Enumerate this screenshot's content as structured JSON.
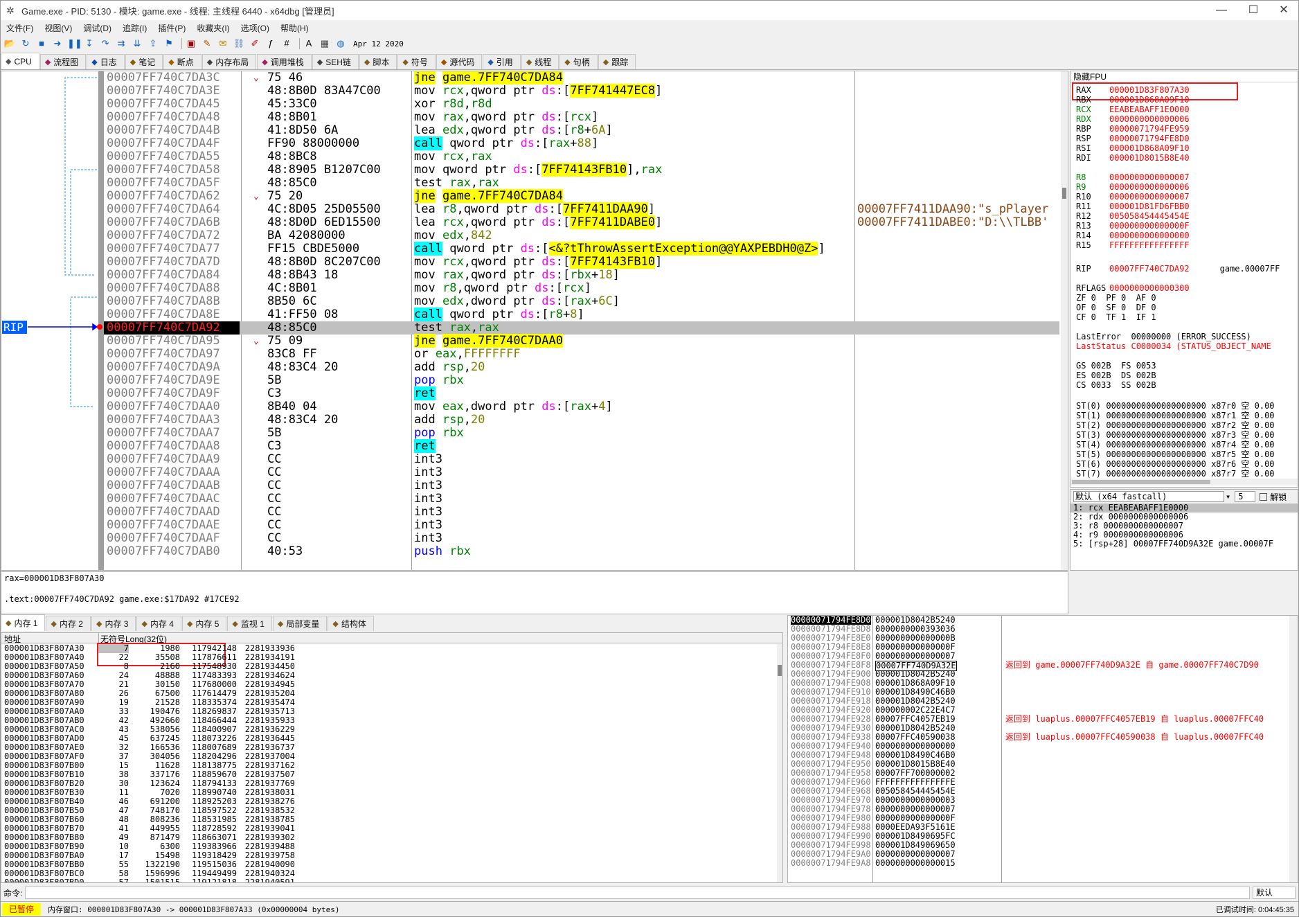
{
  "title": "Game.exe - PID: 5130 - 模块: game.exe - 线程: 主线程 6440 - x64dbg [管理员]",
  "menu": [
    "文件(F)",
    "视图(V)",
    "调试(D)",
    "追踪(I)",
    "插件(P)",
    "收藏夹(I)",
    "选项(O)",
    "帮助(H)",
    "Apr 12 2020"
  ],
  "tabs": [
    {
      "label": "CPU",
      "icon": "cpu-icon"
    },
    {
      "label": "流程图",
      "icon": "graph-icon"
    },
    {
      "label": "日志",
      "icon": "log-icon"
    },
    {
      "label": "笔记",
      "icon": "notes-icon"
    },
    {
      "label": "断点",
      "icon": "breakpoint-icon"
    },
    {
      "label": "内存布局",
      "icon": "memory-map-icon"
    },
    {
      "label": "调用堆栈",
      "icon": "callstack-icon"
    },
    {
      "label": "SEH链",
      "icon": "seh-icon"
    },
    {
      "label": "脚本",
      "icon": "script-icon"
    },
    {
      "label": "符号",
      "icon": "symbol-icon"
    },
    {
      "label": "源代码",
      "icon": "source-icon"
    },
    {
      "label": "引用",
      "icon": "references-icon"
    },
    {
      "label": "线程",
      "icon": "threads-icon"
    },
    {
      "label": "句柄",
      "icon": "handles-icon"
    },
    {
      "label": "跟踪",
      "icon": "trace-icon"
    }
  ],
  "rip_label": "RIP",
  "disasm": [
    {
      "addr": "00007FF740C7DA3C",
      "bytes": "75 46",
      "mn": "jne",
      "ops": "game.7FF740C7DA84",
      "type": "jump"
    },
    {
      "addr": "00007FF740C7DA3E",
      "bytes": "48:8B0D 83A47C00",
      "mn": "mov",
      "ops": "rcx,qword ptr ds:[7FF741447EC8]",
      "type": "mov"
    },
    {
      "addr": "00007FF740C7DA45",
      "bytes": "45:33C0",
      "mn": "xor",
      "ops": "r8d,r8d",
      "type": "plain"
    },
    {
      "addr": "00007FF740C7DA48",
      "bytes": "48:8B01",
      "mn": "mov",
      "ops": "rax,qword ptr ds:[rcx]",
      "type": "plain"
    },
    {
      "addr": "00007FF740C7DA4B",
      "bytes": "41:8D50 6A",
      "mn": "lea",
      "ops": "edx,qword ptr ds:[r8+6A]",
      "type": "plain"
    },
    {
      "addr": "00007FF740C7DA4F",
      "bytes": "FF90 88000000",
      "mn": "call",
      "ops": "qword ptr ds:[rax+88]",
      "type": "call"
    },
    {
      "addr": "00007FF740C7DA55",
      "bytes": "48:8BC8",
      "mn": "mov",
      "ops": "rcx,rax",
      "type": "plain"
    },
    {
      "addr": "00007FF740C7DA58",
      "bytes": "48:8905 B1207C00",
      "mn": "mov",
      "ops": "qword ptr ds:[7FF74143FB10],rax",
      "type": "mov"
    },
    {
      "addr": "00007FF740C7DA5F",
      "bytes": "48:85C0",
      "mn": "test",
      "ops": "rax,rax",
      "type": "plain"
    },
    {
      "addr": "00007FF740C7DA62",
      "bytes": "75 20",
      "mn": "jne",
      "ops": "game.7FF740C7DA84",
      "type": "jump"
    },
    {
      "addr": "00007FF740C7DA64",
      "bytes": "4C:8D05 25D05500",
      "mn": "lea",
      "ops": "r8,qword ptr ds:[7FF7411DAA90]",
      "type": "mov",
      "comment": "00007FF7411DAA90:\"s_pPlayer"
    },
    {
      "addr": "00007FF740C7DA6B",
      "bytes": "48:8D0D 6ED15500",
      "mn": "lea",
      "ops": "rcx,qword ptr ds:[7FF7411DABE0]",
      "type": "mov",
      "comment": "00007FF7411DABE0:\"D:\\\\TLBB'"
    },
    {
      "addr": "00007FF740C7DA72",
      "bytes": "BA 42080000",
      "mn": "mov",
      "ops": "edx,842",
      "type": "plain"
    },
    {
      "addr": "00007FF740C7DA77",
      "bytes": "FF15 CBDE5000",
      "mn": "call",
      "ops": "qword ptr ds:[<&?tThrowAssertException@@YAXPEBDH0@Z>]",
      "type": "call"
    },
    {
      "addr": "00007FF740C7DA7D",
      "bytes": "48:8B0D 8C207C00",
      "mn": "mov",
      "ops": "rcx,qword ptr ds:[7FF74143FB10]",
      "type": "mov"
    },
    {
      "addr": "00007FF740C7DA84",
      "bytes": "48:8B43 18",
      "mn": "mov",
      "ops": "rax,qword ptr ds:[rbx+18]",
      "type": "plain"
    },
    {
      "addr": "00007FF740C7DA88",
      "bytes": "4C:8B01",
      "mn": "mov",
      "ops": "r8,qword ptr ds:[rcx]",
      "type": "plain"
    },
    {
      "addr": "00007FF740C7DA8B",
      "bytes": "8B50 6C",
      "mn": "mov",
      "ops": "edx,dword ptr ds:[rax+6C]",
      "type": "plain"
    },
    {
      "addr": "00007FF740C7DA8E",
      "bytes": "41:FF50 08",
      "mn": "call",
      "ops": "qword ptr ds:[r8+8]",
      "type": "call"
    },
    {
      "addr": "00007FF740C7DA92",
      "bytes": "48:85C0",
      "mn": "test",
      "ops": "rax,rax",
      "type": "plain",
      "current": true
    },
    {
      "addr": "00007FF740C7DA95",
      "bytes": "75 09",
      "mn": "jne",
      "ops": "game.7FF740C7DAA0",
      "type": "jump"
    },
    {
      "addr": "00007FF740C7DA97",
      "bytes": "83C8 FF",
      "mn": "or",
      "ops": "eax,FFFFFFFF",
      "type": "plain"
    },
    {
      "addr": "00007FF740C7DA9A",
      "bytes": "48:83C4 20",
      "mn": "add",
      "ops": "rsp,20",
      "type": "plain"
    },
    {
      "addr": "00007FF740C7DA9E",
      "bytes": "5B",
      "mn": "pop",
      "ops": "rbx",
      "type": "pp"
    },
    {
      "addr": "00007FF740C7DA9F",
      "bytes": "C3",
      "mn": "ret",
      "ops": "",
      "type": "ret"
    },
    {
      "addr": "00007FF740C7DAA0",
      "bytes": "8B40 04",
      "mn": "mov",
      "ops": "eax,dword ptr ds:[rax+4]",
      "type": "plain"
    },
    {
      "addr": "00007FF740C7DAA3",
      "bytes": "48:83C4 20",
      "mn": "add",
      "ops": "rsp,20",
      "type": "plain"
    },
    {
      "addr": "00007FF740C7DAA7",
      "bytes": "5B",
      "mn": "pop",
      "ops": "rbx",
      "type": "pp"
    },
    {
      "addr": "00007FF740C7DAA8",
      "bytes": "C3",
      "mn": "ret",
      "ops": "",
      "type": "ret"
    },
    {
      "addr": "00007FF740C7DAA9",
      "bytes": "CC",
      "mn": "int3",
      "ops": "",
      "type": "plain"
    },
    {
      "addr": "00007FF740C7DAAA",
      "bytes": "CC",
      "mn": "int3",
      "ops": "",
      "type": "plain"
    },
    {
      "addr": "00007FF740C7DAAB",
      "bytes": "CC",
      "mn": "int3",
      "ops": "",
      "type": "plain"
    },
    {
      "addr": "00007FF740C7DAAC",
      "bytes": "CC",
      "mn": "int3",
      "ops": "",
      "type": "plain"
    },
    {
      "addr": "00007FF740C7DAAD",
      "bytes": "CC",
      "mn": "int3",
      "ops": "",
      "type": "plain"
    },
    {
      "addr": "00007FF740C7DAAE",
      "bytes": "CC",
      "mn": "int3",
      "ops": "",
      "type": "plain"
    },
    {
      "addr": "00007FF740C7DAAF",
      "bytes": "CC",
      "mn": "int3",
      "ops": "",
      "type": "plain"
    },
    {
      "addr": "00007FF740C7DAB0",
      "bytes": "40:53",
      "mn": "push",
      "ops": "rbx",
      "type": "pp"
    }
  ],
  "regs_header": "隐藏FPU",
  "registers": [
    {
      "n": "RAX",
      "v": "000001D83F807A30"
    },
    {
      "n": "RBX",
      "v": "000001D868A09F10"
    },
    {
      "n": "RCX",
      "v": "EEABEABAFF1E0000"
    },
    {
      "n": "RDX",
      "v": "0000000000000006"
    },
    {
      "n": "RBP",
      "v": "00000071794FE959"
    },
    {
      "n": "RSP",
      "v": "00000071794FE8D0"
    },
    {
      "n": "RSI",
      "v": "000001D868A09F10"
    },
    {
      "n": "RDI",
      "v": "000001D8015B8E40"
    },
    {
      "n": "R8",
      "v": "0000000000000007"
    },
    {
      "n": "R9",
      "v": "0000000000000006"
    },
    {
      "n": "R10",
      "v": "0000000000000007"
    },
    {
      "n": "R11",
      "v": "000001D81FD6FBB0"
    },
    {
      "n": "R12",
      "v": "005058454445454E"
    },
    {
      "n": "R13",
      "v": "000000000000000F"
    },
    {
      "n": "R14",
      "v": "0000000000000000"
    },
    {
      "n": "R15",
      "v": "FFFFFFFFFFFFFFFF"
    }
  ],
  "rip": {
    "n": "RIP",
    "v": "00007FF740C7DA92",
    "c": "game.00007FF"
  },
  "rflags": {
    "n": "RFLAGS",
    "v": "0000000000000300"
  },
  "flags": [
    "ZF 0  PF 0  AF 0",
    "OF 0  SF 0  DF 0",
    "CF 0  TF 1  IF 1"
  ],
  "lasterror": "LastError  00000000 (ERROR_SUCCESS)",
  "laststatus": "LastStatus C0000034 (STATUS_OBJECT_NAME",
  "segs": [
    "GS 002B  FS 0053",
    "ES 002B  DS 002B",
    "CS 0033  SS 002B"
  ],
  "fpu": [
    "ST(0) 00000000000000000000 x87r0 空 0.00",
    "ST(1) 00000000000000000000 x87r1 空 0.00",
    "ST(2) 00000000000000000000 x87r2 空 0.00",
    "ST(3) 00000000000000000000 x87r3 空 0.00",
    "ST(4) 00000000000000000000 x87r4 空 0.00",
    "ST(5) 00000000000000000000 x87r5 空 0.00",
    "ST(6) 00000000000000000000 x87r6 空 0.00",
    "ST(7) 00000000000000000000 x87r7 空 0.00"
  ],
  "callconv": {
    "select": "默认 (x64 fastcall)",
    "count": "5",
    "unlock": "解锁",
    "lines": [
      "1: rcx EEABEABAFF1E0000",
      "2: rdx 0000000000000006",
      "3: r8 0000000000000007",
      "4: r9 0000000000000006",
      "5: [rsp+28] 00007FF740D9A32E game.00007F"
    ]
  },
  "info": {
    "line1": "rax=000001D83F807A30",
    "line2": ".text:00007FF740C7DA92 game.exe:$17DA92 #17CE92"
  },
  "bottom_tabs": [
    {
      "label": "内存 1",
      "icon": "dump-icon"
    },
    {
      "label": "内存 2",
      "icon": "dump-icon"
    },
    {
      "label": "内存 3",
      "icon": "dump-icon"
    },
    {
      "label": "内存 4",
      "icon": "dump-icon"
    },
    {
      "label": "内存 5",
      "icon": "dump-icon"
    },
    {
      "label": "监视 1",
      "icon": "watch-icon"
    },
    {
      "label": "局部变量",
      "icon": "locals-icon"
    },
    {
      "label": "结构体",
      "icon": "struct-icon"
    }
  ],
  "dump": {
    "col_addr": "地址",
    "col_val": "无符号Long(32位)",
    "rows": [
      [
        "000001D83F807A30",
        "7",
        "1980",
        "117942148",
        "2281933936"
      ],
      [
        "000001D83F807A40",
        "22",
        "35508",
        "117876611",
        "2281934191"
      ],
      [
        "000001D83F807A50",
        "8",
        "2160",
        "117548930",
        "2281934450"
      ],
      [
        "000001D83F807A60",
        "24",
        "48888",
        "117483393",
        "2281934624"
      ],
      [
        "000001D83F807A70",
        "21",
        "30150",
        "117680000",
        "2281934945"
      ],
      [
        "000001D83F807A80",
        "26",
        "67500",
        "117614479",
        "2281935204"
      ],
      [
        "000001D83F807A90",
        "19",
        "21528",
        "118335374",
        "2281935474"
      ],
      [
        "000001D83F807AA0",
        "33",
        "190476",
        "118269837",
        "2281935713"
      ],
      [
        "000001D83F807AB0",
        "42",
        "492660",
        "118466444",
        "2281935933"
      ],
      [
        "000001D83F807AC0",
        "43",
        "538056",
        "118400907",
        "2281936229"
      ],
      [
        "000001D83F807AD0",
        "45",
        "637245",
        "118073226",
        "2281936445"
      ],
      [
        "000001D83F807AE0",
        "32",
        "166536",
        "118007689",
        "2281936737"
      ],
      [
        "000001D83F807AF0",
        "37",
        "304056",
        "118204296",
        "2281937004"
      ],
      [
        "000001D83F807B00",
        "15",
        "11628",
        "118138775",
        "2281937162"
      ],
      [
        "000001D83F807B10",
        "38",
        "337176",
        "118859670",
        "2281937507"
      ],
      [
        "000001D83F807B20",
        "30",
        "123624",
        "118794133",
        "2281937769"
      ],
      [
        "000001D83F807B30",
        "11",
        "7020",
        "118990740",
        "2281938031"
      ],
      [
        "000001D83F807B40",
        "46",
        "691200",
        "118925203",
        "2281938276"
      ],
      [
        "000001D83F807B50",
        "47",
        "748170",
        "118597522",
        "2281938532"
      ],
      [
        "000001D83F807B60",
        "48",
        "808236",
        "118531985",
        "2281938785"
      ],
      [
        "000001D83F807B70",
        "41",
        "449955",
        "118728592",
        "2281939041"
      ],
      [
        "000001D83F807B80",
        "49",
        "871479",
        "118663071",
        "2281939302"
      ],
      [
        "000001D83F807B90",
        "10",
        "6300",
        "119383966",
        "2281939488"
      ],
      [
        "000001D83F807BA0",
        "17",
        "15498",
        "119318429",
        "2281939758"
      ],
      [
        "000001D83F807BB0",
        "55",
        "1322190",
        "119515036",
        "2281940090"
      ],
      [
        "000001D83F807BC0",
        "58",
        "1596996",
        "119449499",
        "2281940324"
      ],
      [
        "000001D83F807BD0",
        "57",
        "1501515",
        "119121818",
        "2281940591"
      ]
    ]
  },
  "stack": [
    {
      "a": "00000071794FE8D0",
      "v": "000001D8042B5240",
      "c": ""
    },
    {
      "a": "00000071794FE8D8",
      "v": "0000000000393036",
      "c": ""
    },
    {
      "a": "00000071794FE8E0",
      "v": "000000000000000B",
      "c": ""
    },
    {
      "a": "00000071794FE8E8",
      "v": "000000000000000F",
      "c": ""
    },
    {
      "a": "00000071794FE8F0",
      "v": "0000000000000007",
      "c": ""
    },
    {
      "a": "00000071794FE8F8",
      "v": "00007FF740D9A32E",
      "c": "返回到 game.00007FF740D9A32E 自 game.00007FF740C7D90"
    },
    {
      "a": "00000071794FE900",
      "v": "000001D8042B5240",
      "c": ""
    },
    {
      "a": "00000071794FE908",
      "v": "000001D868A09F10",
      "c": ""
    },
    {
      "a": "00000071794FE910",
      "v": "000001D8490C46B0",
      "c": ""
    },
    {
      "a": "00000071794FE918",
      "v": "000001D8042B5240",
      "c": ""
    },
    {
      "a": "00000071794FE920",
      "v": "000000002C22E4C7",
      "c": ""
    },
    {
      "a": "00000071794FE928",
      "v": "00007FFC4057EB19",
      "c": "返回到 luaplus.00007FFC4057EB19 自 luaplus.00007FFC40"
    },
    {
      "a": "00000071794FE930",
      "v": "000001D8042B5240",
      "c": ""
    },
    {
      "a": "00000071794FE938",
      "v": "00007FFC40590038",
      "c": "返回到 luaplus.00007FFC40590038 自 luaplus.00007FFC40"
    },
    {
      "a": "00000071794FE940",
      "v": "0000000000000000",
      "c": ""
    },
    {
      "a": "00000071794FE948",
      "v": "000001D8490C46B0",
      "c": ""
    },
    {
      "a": "00000071794FE950",
      "v": "000001D8015B8E40",
      "c": ""
    },
    {
      "a": "00000071794FE958",
      "v": "00007FF700000002",
      "c": ""
    },
    {
      "a": "00000071794FE960",
      "v": "FFFFFFFFFFFFFFFE",
      "c": ""
    },
    {
      "a": "00000071794FE968",
      "v": "005058454445454E",
      "c": ""
    },
    {
      "a": "00000071794FE970",
      "v": "0000000000000003",
      "c": ""
    },
    {
      "a": "00000071794FE978",
      "v": "0000000000000007",
      "c": ""
    },
    {
      "a": "00000071794FE980",
      "v": "000000000000000F",
      "c": ""
    },
    {
      "a": "00000071794FE988",
      "v": "0000EEDA93F5161E",
      "c": ""
    },
    {
      "a": "00000071794FE990",
      "v": "000001D8490695FC",
      "c": ""
    },
    {
      "a": "00000071794FE998",
      "v": "000001D849069650",
      "c": ""
    },
    {
      "a": "00000071794FE9A0",
      "v": "0000000000000007",
      "c": ""
    },
    {
      "a": "00000071794FE9A8",
      "v": "0000000000000015",
      "c": ""
    }
  ],
  "cmd_label": "命令:",
  "cmd_default": "默认",
  "status": {
    "paused": "已暂停",
    "msg": "内存窗口: 000001D83F807A30 -> 000001D83F807A33 (0x00000004 bytes)",
    "time": "已调试时间:  0:04:45:35"
  }
}
